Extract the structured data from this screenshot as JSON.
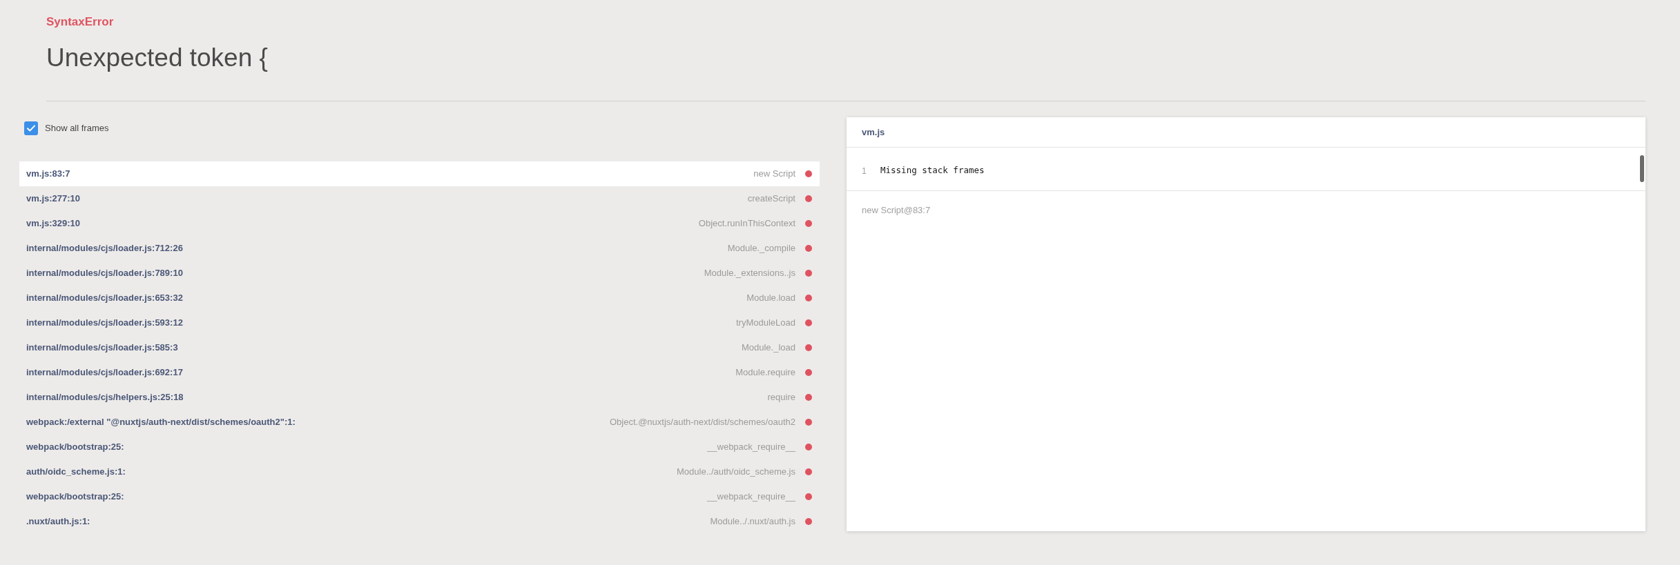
{
  "error": {
    "type": "SyntaxError",
    "message": "Unexpected token {"
  },
  "show_all_frames": {
    "label": "Show all frames",
    "checked": true
  },
  "frames": [
    {
      "location": "vm.js:83:7",
      "function": "new Script",
      "selected": true
    },
    {
      "location": "vm.js:277:10",
      "function": "createScript",
      "selected": false
    },
    {
      "location": "vm.js:329:10",
      "function": "Object.runInThisContext",
      "selected": false
    },
    {
      "location": "internal/modules/cjs/loader.js:712:26",
      "function": "Module._compile",
      "selected": false
    },
    {
      "location": "internal/modules/cjs/loader.js:789:10",
      "function": "Module._extensions..js",
      "selected": false
    },
    {
      "location": "internal/modules/cjs/loader.js:653:32",
      "function": "Module.load",
      "selected": false
    },
    {
      "location": "internal/modules/cjs/loader.js:593:12",
      "function": "tryModuleLoad",
      "selected": false
    },
    {
      "location": "internal/modules/cjs/loader.js:585:3",
      "function": "Module._load",
      "selected": false
    },
    {
      "location": "internal/modules/cjs/loader.js:692:17",
      "function": "Module.require",
      "selected": false
    },
    {
      "location": "internal/modules/cjs/helpers.js:25:18",
      "function": "require",
      "selected": false
    },
    {
      "location": "webpack:/external \"@nuxtjs/auth-next/dist/schemes/oauth2\":1:",
      "function": "Object.@nuxtjs/auth-next/dist/schemes/oauth2",
      "selected": false
    },
    {
      "location": "webpack/bootstrap:25:",
      "function": "__webpack_require__",
      "selected": false
    },
    {
      "location": "auth/oidc_scheme.js:1:",
      "function": "Module../auth/oidc_scheme.js",
      "selected": false
    },
    {
      "location": "webpack/bootstrap:25:",
      "function": "__webpack_require__",
      "selected": false
    },
    {
      "location": ".nuxt/auth.js:1:",
      "function": "Module../.nuxt/auth.js",
      "selected": false
    }
  ],
  "source_panel": {
    "file": "vm.js",
    "lines": [
      {
        "number": "1",
        "code": "Missing stack frames"
      }
    ],
    "footer": "new Script@83:7"
  }
}
